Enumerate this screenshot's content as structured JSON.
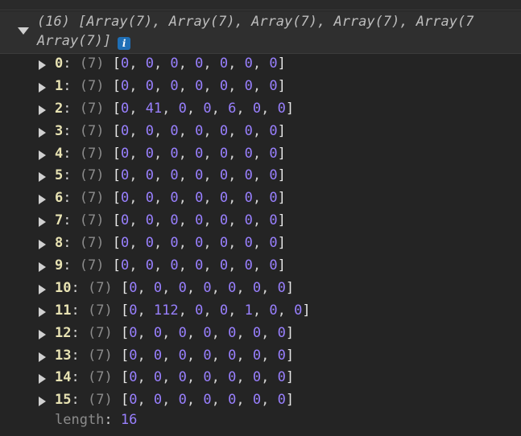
{
  "summary": {
    "line1": "(16) [Array(7), Array(7), Array(7), Array(7), Array(7",
    "line2": "Array(7)]",
    "info_icon_label": "i"
  },
  "rows": [
    {
      "index": "0",
      "length_label": "(7)",
      "values": [
        "0",
        "0",
        "0",
        "0",
        "0",
        "0",
        "0"
      ]
    },
    {
      "index": "1",
      "length_label": "(7)",
      "values": [
        "0",
        "0",
        "0",
        "0",
        "0",
        "0",
        "0"
      ]
    },
    {
      "index": "2",
      "length_label": "(7)",
      "values": [
        "0",
        "41",
        "0",
        "0",
        "6",
        "0",
        "0"
      ]
    },
    {
      "index": "3",
      "length_label": "(7)",
      "values": [
        "0",
        "0",
        "0",
        "0",
        "0",
        "0",
        "0"
      ]
    },
    {
      "index": "4",
      "length_label": "(7)",
      "values": [
        "0",
        "0",
        "0",
        "0",
        "0",
        "0",
        "0"
      ]
    },
    {
      "index": "5",
      "length_label": "(7)",
      "values": [
        "0",
        "0",
        "0",
        "0",
        "0",
        "0",
        "0"
      ]
    },
    {
      "index": "6",
      "length_label": "(7)",
      "values": [
        "0",
        "0",
        "0",
        "0",
        "0",
        "0",
        "0"
      ]
    },
    {
      "index": "7",
      "length_label": "(7)",
      "values": [
        "0",
        "0",
        "0",
        "0",
        "0",
        "0",
        "0"
      ]
    },
    {
      "index": "8",
      "length_label": "(7)",
      "values": [
        "0",
        "0",
        "0",
        "0",
        "0",
        "0",
        "0"
      ]
    },
    {
      "index": "9",
      "length_label": "(7)",
      "values": [
        "0",
        "0",
        "0",
        "0",
        "0",
        "0",
        "0"
      ]
    },
    {
      "index": "10",
      "length_label": "(7)",
      "values": [
        "0",
        "0",
        "0",
        "0",
        "0",
        "0",
        "0"
      ]
    },
    {
      "index": "11",
      "length_label": "(7)",
      "values": [
        "0",
        "112",
        "0",
        "0",
        "1",
        "0",
        "0"
      ]
    },
    {
      "index": "12",
      "length_label": "(7)",
      "values": [
        "0",
        "0",
        "0",
        "0",
        "0",
        "0",
        "0"
      ]
    },
    {
      "index": "13",
      "length_label": "(7)",
      "values": [
        "0",
        "0",
        "0",
        "0",
        "0",
        "0",
        "0"
      ]
    },
    {
      "index": "14",
      "length_label": "(7)",
      "values": [
        "0",
        "0",
        "0",
        "0",
        "0",
        "0",
        "0"
      ]
    },
    {
      "index": "15",
      "length_label": "(7)",
      "values": [
        "0",
        "0",
        "0",
        "0",
        "0",
        "0",
        "0"
      ]
    }
  ],
  "length": {
    "key": "length",
    "value": "16"
  },
  "colors": {
    "background": "#242424",
    "number": "#9980ff",
    "index": "#e8e3b3",
    "info_icon": "#1f6fb6"
  }
}
